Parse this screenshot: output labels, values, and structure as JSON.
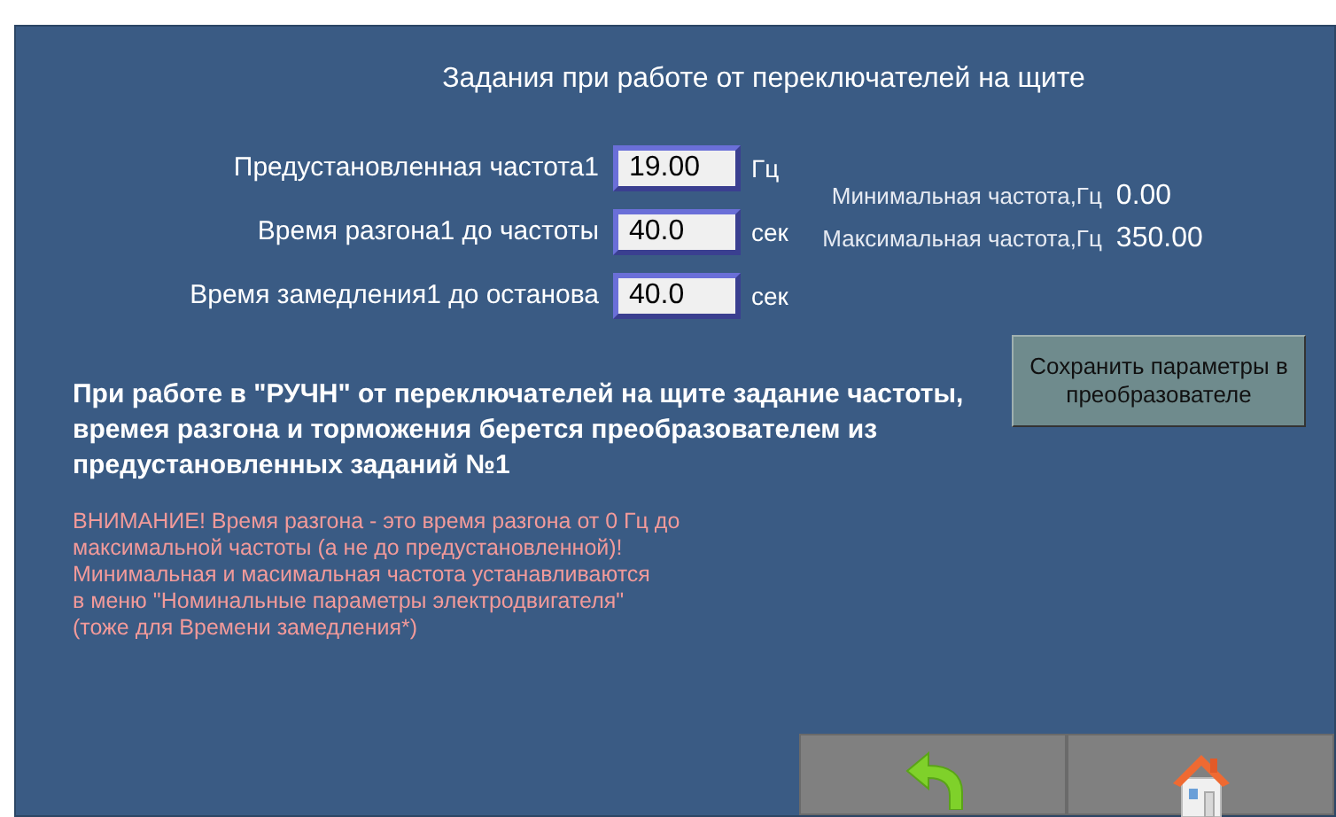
{
  "title": "Задания при работе от переключателей на щите",
  "settings": [
    {
      "label": "Предустановленная частота1",
      "value": "19.00",
      "unit": "Гц"
    },
    {
      "label": "Время разгона1 до частоты",
      "value": "40.0",
      "unit": "сек"
    },
    {
      "label": "Время замедления1 до останова",
      "value": "40.0",
      "unit": "сек"
    }
  ],
  "limits": [
    {
      "label": "Минимальная частота,Гц",
      "value": "0.00"
    },
    {
      "label": "Максимальная частота,Гц",
      "value": "350.00"
    }
  ],
  "info": "При работе в \"РУЧН\" от переключателей на щите задание частоты, времея разгона и торможения берется преобразователем из предустановленных заданий №1",
  "warning": [
    "ВНИМАНИЕ! Время разгона - это время разгона от 0 Гц до",
    "максимальной частоты (а не до предустановленной)!",
    "Минимальная и масимальная частота устанавливаются",
    "в меню \"Номинальные параметры электродвигателя\"",
    "(тоже для Времени замедления*)"
  ],
  "save_button": "Сохранить параметры в преобразователе",
  "nav_buttons": [
    {
      "kind": "back"
    },
    {
      "kind": "home"
    }
  ]
}
